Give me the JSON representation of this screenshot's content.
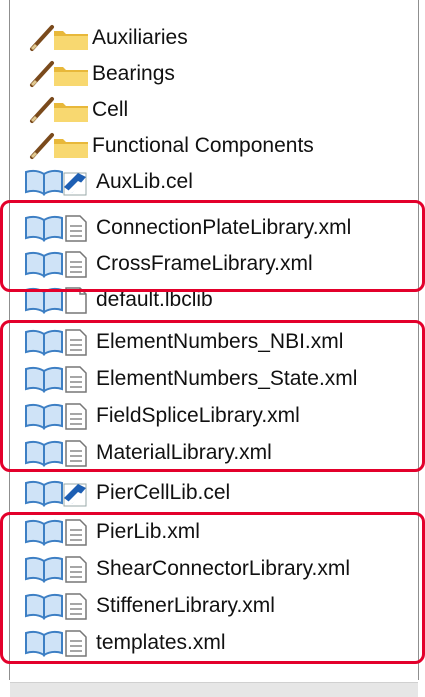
{
  "tree": {
    "items": [
      {
        "label": "Auxiliaries",
        "kind": "folder",
        "icon": "pencil-folder-icon"
      },
      {
        "label": "Bearings",
        "kind": "folder",
        "icon": "pencil-folder-icon"
      },
      {
        "label": "Cell",
        "kind": "folder",
        "icon": "pencil-folder-icon"
      },
      {
        "label": "Functional Components",
        "kind": "folder",
        "icon": "pencil-folder-icon"
      },
      {
        "label": "AuxLib.cel",
        "kind": "cell",
        "icon": "book-cell-file-icon"
      },
      {
        "label": "ConnectionPlateLibrary.xml",
        "kind": "file",
        "icon": "book-document-icon"
      },
      {
        "label": "CrossFrameLibrary.xml",
        "kind": "file",
        "icon": "book-document-icon"
      },
      {
        "label": "default.lbclib",
        "kind": "blank",
        "icon": "book-blank-file-icon"
      },
      {
        "label": "ElementNumbers_NBI.xml",
        "kind": "file",
        "icon": "book-document-icon"
      },
      {
        "label": "ElementNumbers_State.xml",
        "kind": "file",
        "icon": "book-document-icon"
      },
      {
        "label": "FieldSpliceLibrary.xml",
        "kind": "file",
        "icon": "book-document-icon"
      },
      {
        "label": "MaterialLibrary.xml",
        "kind": "file",
        "icon": "book-document-icon"
      },
      {
        "label": "PierCellLib.cel",
        "kind": "cell",
        "icon": "book-cell-file-icon"
      },
      {
        "label": "PierLib.xml",
        "kind": "file",
        "icon": "book-document-icon"
      },
      {
        "label": "ShearConnectorLibrary.xml",
        "kind": "file",
        "icon": "book-document-icon"
      },
      {
        "label": "StiffenerLibrary.xml",
        "kind": "file",
        "icon": "book-document-icon"
      },
      {
        "label": "templates.xml",
        "kind": "file",
        "icon": "book-document-icon"
      }
    ]
  },
  "colors": {
    "highlight": "#e3002b",
    "folder": "#f3c94d",
    "pencil": "#7a4a1c",
    "book": "#3d7fc4"
  }
}
